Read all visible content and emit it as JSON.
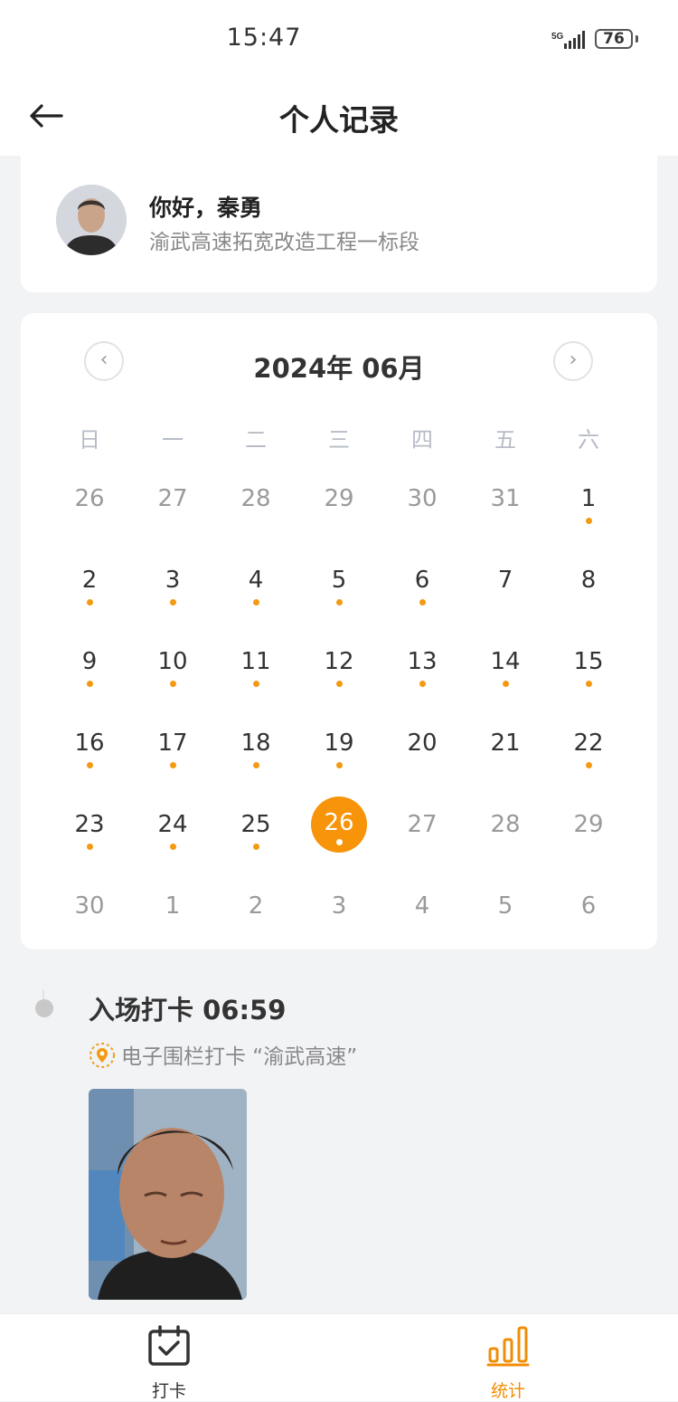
{
  "status_bar": {
    "time": "15:47",
    "network": "5G",
    "battery": "76"
  },
  "header": {
    "title": "个人记录"
  },
  "profile": {
    "greeting": "你好，秦勇",
    "project": "渝武高速拓宽改造工程一标段"
  },
  "calendar": {
    "title": "2024年 06月",
    "prev_label": "‹",
    "next_label": "›",
    "weekdays": [
      "日",
      "一",
      "二",
      "三",
      "四",
      "五",
      "六"
    ],
    "weeks": [
      [
        {
          "d": "26",
          "cur": false,
          "dot": false
        },
        {
          "d": "27",
          "cur": false,
          "dot": false
        },
        {
          "d": "28",
          "cur": false,
          "dot": false
        },
        {
          "d": "29",
          "cur": false,
          "dot": false
        },
        {
          "d": "30",
          "cur": false,
          "dot": false
        },
        {
          "d": "31",
          "cur": false,
          "dot": false
        },
        {
          "d": "1",
          "cur": true,
          "dot": true
        }
      ],
      [
        {
          "d": "2",
          "cur": true,
          "dot": true
        },
        {
          "d": "3",
          "cur": true,
          "dot": true
        },
        {
          "d": "4",
          "cur": true,
          "dot": true
        },
        {
          "d": "5",
          "cur": true,
          "dot": true
        },
        {
          "d": "6",
          "cur": true,
          "dot": true
        },
        {
          "d": "7",
          "cur": true,
          "dot": false
        },
        {
          "d": "8",
          "cur": true,
          "dot": false
        }
      ],
      [
        {
          "d": "9",
          "cur": true,
          "dot": true
        },
        {
          "d": "10",
          "cur": true,
          "dot": true
        },
        {
          "d": "11",
          "cur": true,
          "dot": true
        },
        {
          "d": "12",
          "cur": true,
          "dot": true
        },
        {
          "d": "13",
          "cur": true,
          "dot": true
        },
        {
          "d": "14",
          "cur": true,
          "dot": true
        },
        {
          "d": "15",
          "cur": true,
          "dot": true
        }
      ],
      [
        {
          "d": "16",
          "cur": true,
          "dot": true
        },
        {
          "d": "17",
          "cur": true,
          "dot": true
        },
        {
          "d": "18",
          "cur": true,
          "dot": true
        },
        {
          "d": "19",
          "cur": true,
          "dot": true
        },
        {
          "d": "20",
          "cur": true,
          "dot": false
        },
        {
          "d": "21",
          "cur": true,
          "dot": false
        },
        {
          "d": "22",
          "cur": true,
          "dot": true
        }
      ],
      [
        {
          "d": "23",
          "cur": true,
          "dot": true
        },
        {
          "d": "24",
          "cur": true,
          "dot": true
        },
        {
          "d": "25",
          "cur": true,
          "dot": true
        },
        {
          "d": "26",
          "cur": true,
          "dot": true,
          "selected": true
        },
        {
          "d": "27",
          "cur": false,
          "dot": false
        },
        {
          "d": "28",
          "cur": false,
          "dot": false
        },
        {
          "d": "29",
          "cur": false,
          "dot": false
        }
      ],
      [
        {
          "d": "30",
          "cur": false,
          "dot": false
        },
        {
          "d": "1",
          "cur": false,
          "dot": false
        },
        {
          "d": "2",
          "cur": false,
          "dot": false
        },
        {
          "d": "3",
          "cur": false,
          "dot": false
        },
        {
          "d": "4",
          "cur": false,
          "dot": false
        },
        {
          "d": "5",
          "cur": false,
          "dot": false
        },
        {
          "d": "6",
          "cur": false,
          "dot": false
        }
      ]
    ]
  },
  "record": {
    "title": "入场打卡 06:59",
    "subtitle": "电子围栏打卡 “渝武高速”"
  },
  "tabbar": {
    "items": [
      {
        "label": "打卡",
        "icon": "calendar-check-icon",
        "active": false
      },
      {
        "label": "统计",
        "icon": "bar-chart-icon",
        "active": true
      }
    ]
  },
  "colors": {
    "accent": "#f7940a",
    "text": "#333333",
    "muted": "#888888",
    "background": "#f2f3f5"
  }
}
